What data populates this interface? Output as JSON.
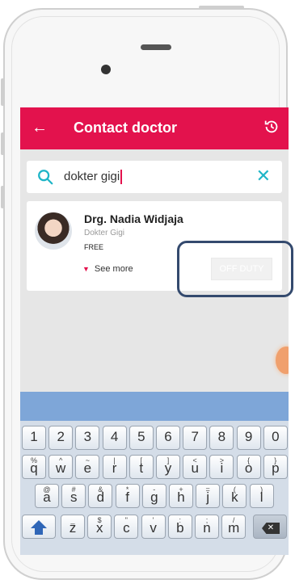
{
  "app_bar": {
    "back_icon": "arrow-left-icon",
    "title": "Contact doctor",
    "history_icon": "history-icon",
    "background_color": "#e3124d"
  },
  "search": {
    "value": "dokter gigi",
    "search_icon": "search-icon",
    "clear_icon": "close-icon",
    "accent_color": "#1fb5c7"
  },
  "doctor_card": {
    "name": "Drg. Nadia Widjaja",
    "specialty": "Dokter Gigi",
    "fee": "FREE",
    "see_more_label": "See more",
    "status_label": "OFF DUTY"
  },
  "keyboard": {
    "number_row": [
      "1",
      "2",
      "3",
      "4",
      "5",
      "6",
      "7",
      "8",
      "9",
      "0"
    ],
    "row1": [
      {
        "main": "q",
        "alt": "%"
      },
      {
        "main": "w",
        "alt": "^"
      },
      {
        "main": "e",
        "alt": "~"
      },
      {
        "main": "r",
        "alt": "|"
      },
      {
        "main": "t",
        "alt": "["
      },
      {
        "main": "y",
        "alt": "]"
      },
      {
        "main": "u",
        "alt": "<"
      },
      {
        "main": "i",
        "alt": ">"
      },
      {
        "main": "o",
        "alt": "{"
      },
      {
        "main": "p",
        "alt": "}"
      }
    ],
    "row2": [
      {
        "main": "a",
        "alt": "@"
      },
      {
        "main": "s",
        "alt": "#"
      },
      {
        "main": "d",
        "alt": "&"
      },
      {
        "main": "f",
        "alt": "*"
      },
      {
        "main": "g",
        "alt": "-"
      },
      {
        "main": "h",
        "alt": "+"
      },
      {
        "main": "j",
        "alt": "="
      },
      {
        "main": "k",
        "alt": "("
      },
      {
        "main": "l",
        "alt": ")"
      }
    ],
    "row3": [
      {
        "main": "z",
        "alt": "_"
      },
      {
        "main": "x",
        "alt": "$"
      },
      {
        "main": "c",
        "alt": "\""
      },
      {
        "main": "v",
        "alt": "'"
      },
      {
        "main": "b",
        "alt": ":"
      },
      {
        "main": "n",
        "alt": ";"
      },
      {
        "main": "m",
        "alt": "/"
      }
    ]
  }
}
